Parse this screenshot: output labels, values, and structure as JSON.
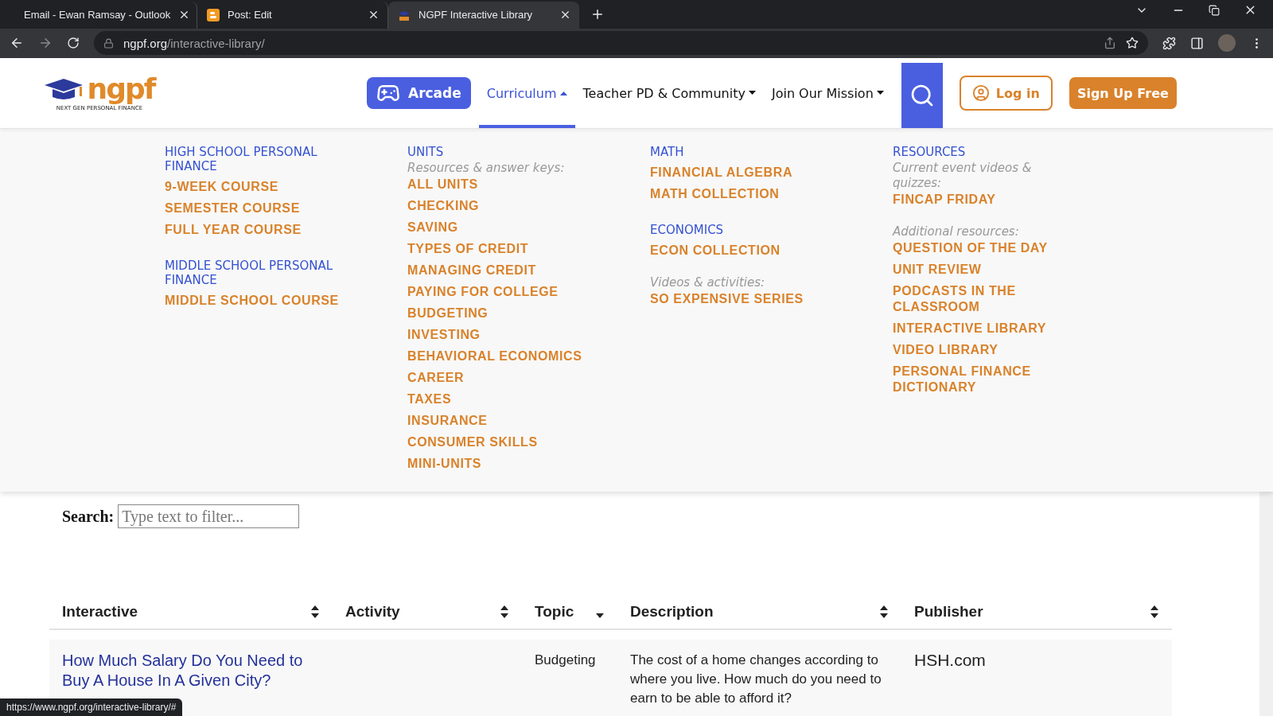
{
  "browser": {
    "tabs": [
      {
        "title": "Email - Ewan Ramsay - Outlook",
        "selected": false
      },
      {
        "title": "Post: Edit",
        "selected": false
      },
      {
        "title": "NGPF Interactive Library",
        "selected": true
      }
    ],
    "url_host": "ngpf.org",
    "url_path": "/interactive-library/"
  },
  "header": {
    "logo_text": "ngpf",
    "logo_tagline": "NEXT GEN PERSONAL FINANCE",
    "nav": [
      {
        "label": "Arcade",
        "kind": "button"
      },
      {
        "label": "Curriculum",
        "kind": "menu",
        "selected": true,
        "expanded": true
      },
      {
        "label": "Teacher PD & Community",
        "kind": "menu",
        "selected": false,
        "expanded": false
      },
      {
        "label": "Join Our Mission",
        "kind": "menu",
        "selected": false,
        "expanded": false
      }
    ],
    "login": "Log in",
    "signup": "Sign Up Free"
  },
  "mega_menu": [
    {
      "groups": [
        {
          "heading": "HIGH SCHOOL PERSONAL FINANCE",
          "links": [
            "9-WEEK COURSE",
            "SEMESTER COURSE",
            "FULL YEAR COURSE"
          ]
        },
        {
          "heading": "MIDDLE SCHOOL PERSONAL FINANCE",
          "links": [
            "MIDDLE SCHOOL COURSE"
          ]
        }
      ]
    },
    {
      "groups": [
        {
          "heading": "UNITS",
          "note": "Resources & answer keys:",
          "links": [
            "ALL UNITS",
            "CHECKING",
            "SAVING",
            "TYPES OF CREDIT",
            "MANAGING CREDIT",
            "PAYING FOR COLLEGE",
            "BUDGETING",
            "INVESTING",
            "BEHAVIORAL ECONOMICS",
            "CAREER",
            "TAXES",
            "INSURANCE",
            "CONSUMER SKILLS",
            "MINI-UNITS"
          ]
        }
      ]
    },
    {
      "groups": [
        {
          "heading": "MATH",
          "links": [
            "FINANCIAL ALGEBRA",
            "MATH COLLECTION"
          ]
        },
        {
          "heading": "ECONOMICS",
          "links": [
            "ECON COLLECTION"
          ]
        },
        {
          "note": "Videos & activities:",
          "links": [
            "SO EXPENSIVE SERIES"
          ]
        }
      ]
    },
    {
      "groups": [
        {
          "heading": "RESOURCES",
          "note": "Current event videos & quizzes:",
          "links": [
            "FINCAP FRIDAY"
          ]
        },
        {
          "note": "Additional resources:",
          "links": [
            "QUESTION OF THE DAY",
            "UNIT REVIEW",
            "PODCASTS IN THE CLASSROOM",
            "INTERACTIVE LIBRARY",
            "VIDEO LIBRARY",
            "PERSONAL FINANCE DICTIONARY"
          ]
        }
      ]
    }
  ],
  "search": {
    "label": "Search:",
    "placeholder": "Type text to filter..."
  },
  "table": {
    "columns": [
      {
        "label": "Interactive",
        "sorted": false
      },
      {
        "label": "Activity",
        "sorted": false
      },
      {
        "label": "Topic",
        "sorted": true
      },
      {
        "label": "Description",
        "sorted": false
      },
      {
        "label": "Publisher",
        "sorted": false
      }
    ],
    "rows": [
      {
        "interactive": "How Much Salary Do You Need to Buy A House In A Given City?",
        "topic": "Budgeting",
        "description": "The cost of a home changes according to where you live. How much do you need to earn to be able to afford it?",
        "publisher": "HSH.com"
      }
    ]
  },
  "status_url": "https://www.ngpf.org/interactive-library/#"
}
